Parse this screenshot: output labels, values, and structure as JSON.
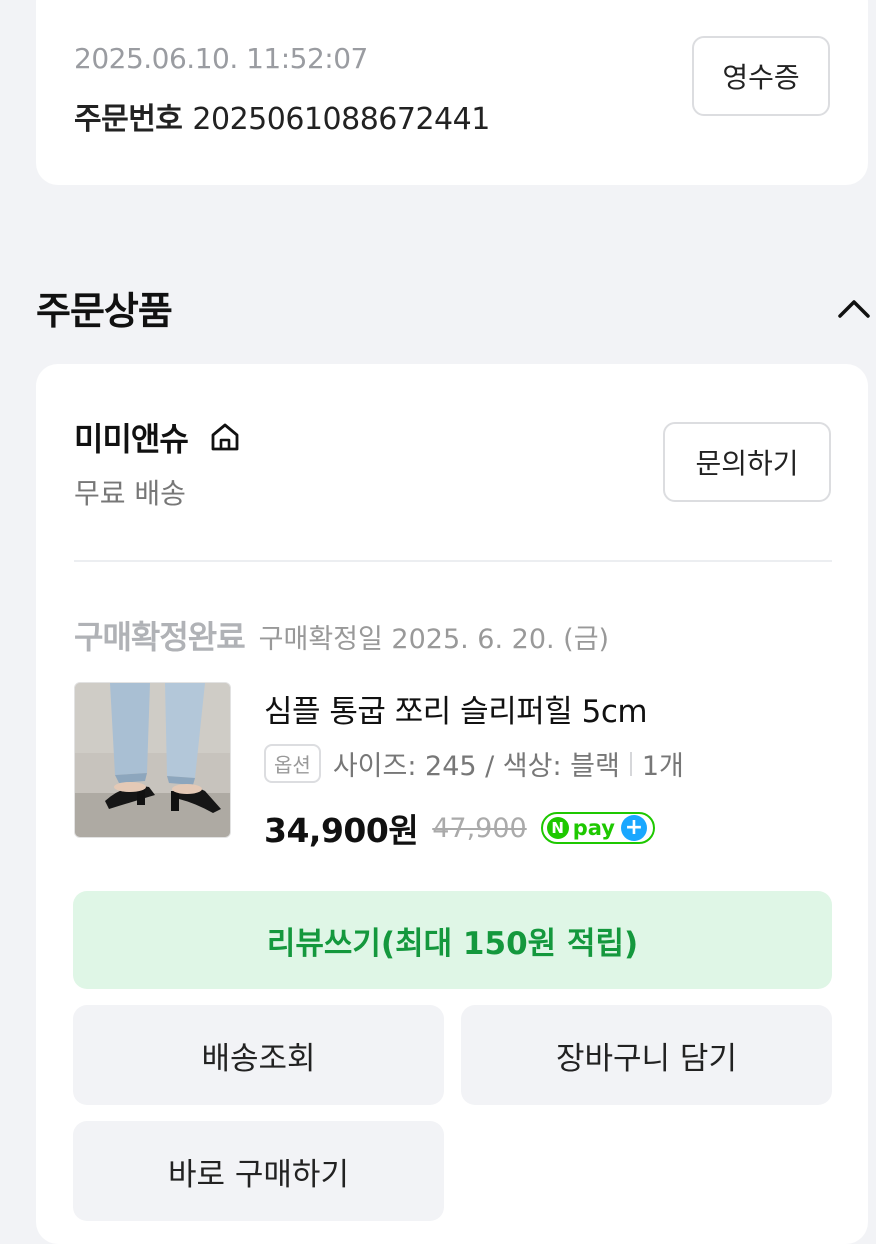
{
  "order": {
    "datetime": "2025.06.10. 11:52:07",
    "number_label": "주문번호",
    "number": "2025061088672441",
    "receipt_label": "영수증"
  },
  "section": {
    "title": "주문상품",
    "collapse_icon": "chevron-up-icon"
  },
  "shop": {
    "name": "미미앤슈",
    "home_icon": "home-icon",
    "shipping": "무료 배송",
    "inquiry_label": "문의하기"
  },
  "item": {
    "status": "구매확정완료",
    "status_date": "구매확정일 2025. 6. 20. (금)",
    "name": "심플 통굽 쪼리 슬리퍼힐 5cm",
    "option_tag": "옵션",
    "option_text": "사이즈: 245 / 색상: 블랙",
    "quantity": "1개",
    "price": "34,900원",
    "original_price": "47,900",
    "npay_n": "N",
    "npay_text": "pay",
    "npay_plus": "+"
  },
  "actions": {
    "review": "리뷰쓰기(최대 150원 적립)",
    "track": "배송조회",
    "cart": "장바구니 담기",
    "buy_now": "바로 구매하기"
  },
  "colors": {
    "accent_green": "#14983d",
    "review_bg": "#dff6e6",
    "npay_green": "#1ec800",
    "npay_blue": "#1aa7ff"
  }
}
